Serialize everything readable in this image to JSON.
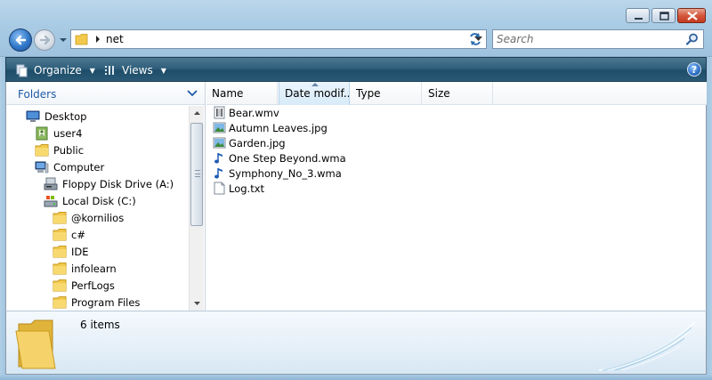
{
  "window": {
    "controls": [
      "minimize",
      "maximize",
      "close"
    ]
  },
  "address_bar": {
    "path": "net"
  },
  "search": {
    "placeholder": "Search"
  },
  "toolbar": {
    "organize_label": "Organize",
    "views_label": "Views",
    "help_label": "?"
  },
  "nav_pane": {
    "header": "Folders",
    "items": [
      {
        "label": "Desktop",
        "icon": "desktop-icon"
      },
      {
        "label": "user4",
        "icon": "user-folder-icon"
      },
      {
        "label": "Public",
        "icon": "folder-icon"
      },
      {
        "label": "Computer",
        "icon": "computer-icon"
      },
      {
        "label": "Floppy Disk Drive (A:)",
        "icon": "floppy-drive-icon"
      },
      {
        "label": "Local Disk (C:)",
        "icon": "hard-disk-icon"
      },
      {
        "label": "@kornilios",
        "icon": "folder-icon"
      },
      {
        "label": "c#",
        "icon": "folder-icon"
      },
      {
        "label": "IDE",
        "icon": "folder-icon"
      },
      {
        "label": "infolearn",
        "icon": "folder-icon"
      },
      {
        "label": "PerfLogs",
        "icon": "folder-icon"
      },
      {
        "label": "Program Files",
        "icon": "folder-icon"
      }
    ]
  },
  "file_list": {
    "columns": [
      "Name",
      "Date modif...",
      "Type",
      "Size"
    ],
    "sorted_column": "Date modif...",
    "files": [
      {
        "name": "Bear.wmv",
        "icon": "video-file-icon"
      },
      {
        "name": "Autumn Leaves.jpg",
        "icon": "image-file-icon"
      },
      {
        "name": "Garden.jpg",
        "icon": "image-file-icon"
      },
      {
        "name": "One Step Beyond.wma",
        "icon": "audio-file-icon"
      },
      {
        "name": "Symphony_No_3.wma",
        "icon": "audio-file-icon"
      },
      {
        "name": "Log.txt",
        "icon": "text-file-icon"
      }
    ]
  },
  "details_pane": {
    "item_count": "6 items"
  },
  "colors": {
    "toolbar": "#2f5f7b",
    "nav_header_text": "#1e5aa8",
    "folder_yellow": "#f2c94c",
    "window_frame": "#a9cbe4"
  }
}
